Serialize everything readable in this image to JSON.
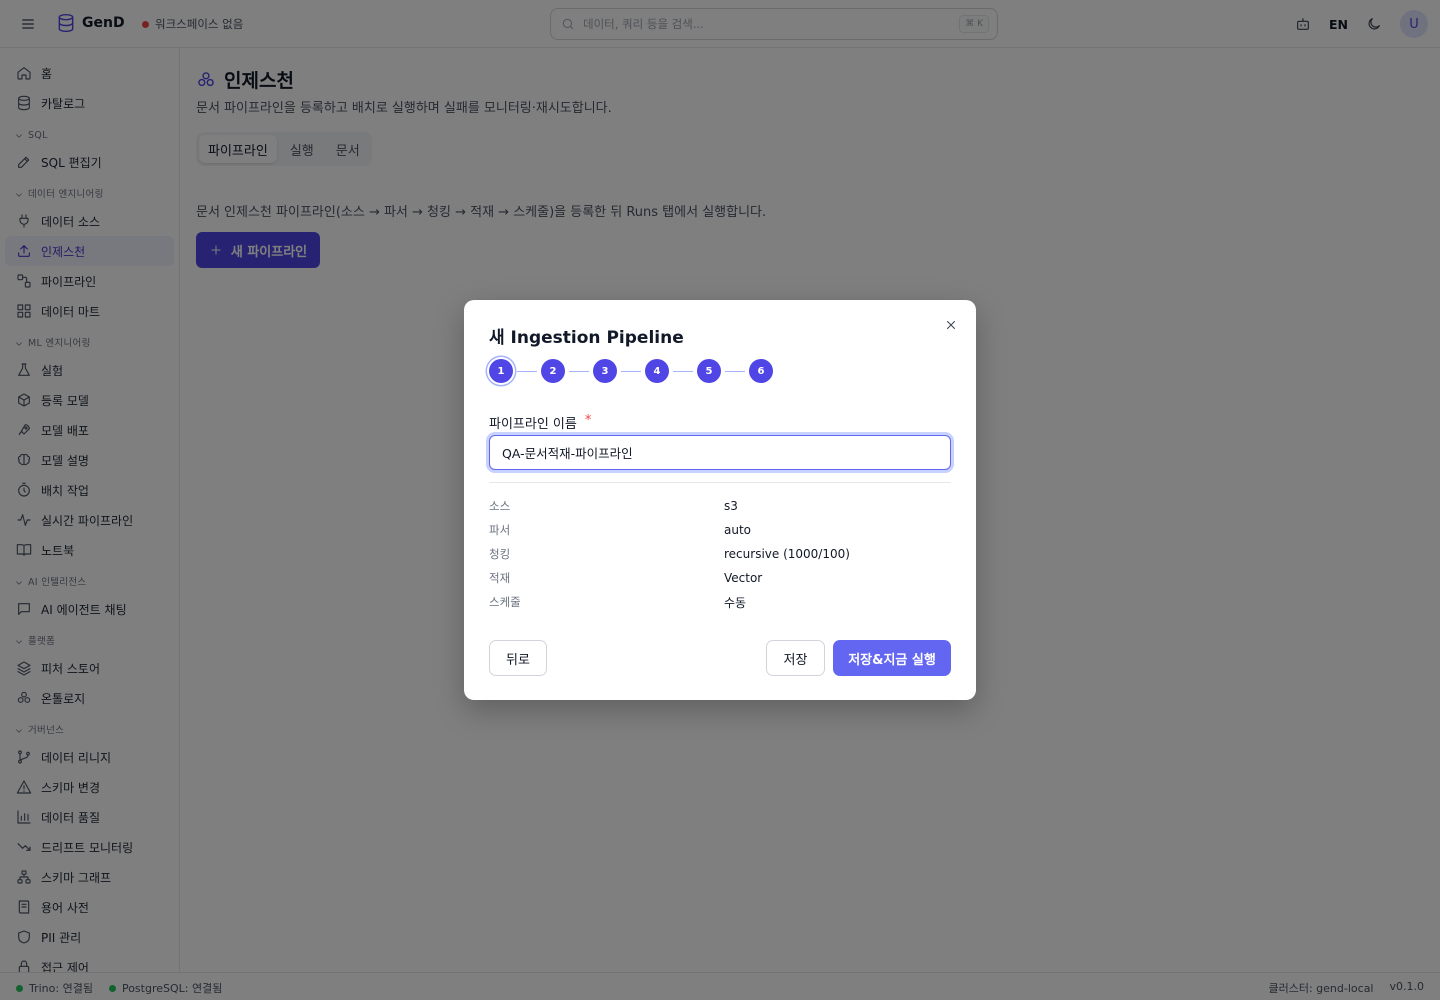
{
  "header": {
    "app_name": "GenD",
    "workspace": "워크스페이스 없음",
    "search_placeholder": "데이터, 쿼리 등을 검색...",
    "search_shortcut": "⌘ K",
    "lang": "EN",
    "avatar": "U"
  },
  "sidebar": {
    "top": [
      {
        "label": "홈",
        "icon": "home-icon"
      },
      {
        "label": "카탈로그",
        "icon": "database-icon"
      }
    ],
    "groups": [
      {
        "title": "SQL",
        "items": [
          {
            "label": "SQL 편집기",
            "icon": "edit-icon"
          }
        ]
      },
      {
        "title": "데이터 엔지니어링",
        "items": [
          {
            "label": "데이터 소스",
            "icon": "plug-icon"
          },
          {
            "label": "인제스천",
            "icon": "upload-icon",
            "active": true
          },
          {
            "label": "파이프라인",
            "icon": "workflow-icon"
          },
          {
            "label": "데이터 마트",
            "icon": "grid-icon"
          }
        ]
      },
      {
        "title": "ML 엔지니어링",
        "items": [
          {
            "label": "실험",
            "icon": "flask-icon"
          },
          {
            "label": "등록 모델",
            "icon": "box-icon"
          },
          {
            "label": "모델 배포",
            "icon": "rocket-icon"
          },
          {
            "label": "모델 설명",
            "icon": "brain-icon"
          },
          {
            "label": "배치 작업",
            "icon": "timer-icon"
          },
          {
            "label": "실시간 파이프라인",
            "icon": "activity-icon"
          },
          {
            "label": "노트북",
            "icon": "book-icon"
          }
        ]
      },
      {
        "title": "AI 인텔리전스",
        "items": [
          {
            "label": "AI 에이전트 채팅",
            "icon": "message-icon"
          }
        ]
      },
      {
        "title": "플랫폼",
        "items": [
          {
            "label": "피처 스토어",
            "icon": "layers-icon"
          },
          {
            "label": "온톨로지",
            "icon": "network-icon"
          }
        ]
      },
      {
        "title": "거버넌스",
        "items": [
          {
            "label": "데이터 리니지",
            "icon": "git-branch-icon"
          },
          {
            "label": "스키마 변경",
            "icon": "alert-triangle-icon"
          },
          {
            "label": "데이터 품질",
            "icon": "bar-chart-icon"
          },
          {
            "label": "드리프트 모니터링",
            "icon": "trending-down-icon"
          },
          {
            "label": "스키마 그래프",
            "icon": "sitemap-icon"
          },
          {
            "label": "용어 사전",
            "icon": "book-text-icon"
          },
          {
            "label": "PII 관리",
            "icon": "shield-icon"
          },
          {
            "label": "접근 제어",
            "icon": "lock-icon"
          }
        ]
      }
    ]
  },
  "page": {
    "title": "인제스천",
    "description": "문서 파이프라인을 등록하고 배치로 실행하며 실패를 모니터링·재시도합니다.",
    "tabs": [
      {
        "label": "파이프라인",
        "active": true
      },
      {
        "label": "실행"
      },
      {
        "label": "문서"
      }
    ],
    "pipeline_desc": "문서 인제스천 파이프라인(소스 → 파서 → 청킹 → 적재 → 스케줄)을 등록한 뒤 Runs 탭에서 실행합니다.",
    "new_button": "새 파이프라인"
  },
  "modal": {
    "title": "새 Ingestion Pipeline",
    "steps": [
      "1",
      "2",
      "3",
      "4",
      "5",
      "6"
    ],
    "current_step": 1,
    "name_label": "파이프라인 이름",
    "required_mark": "*",
    "name_value": "QA-문서적재-파이프라인",
    "summary": [
      {
        "key": "소스",
        "value": "s3"
      },
      {
        "key": "파서",
        "value": "auto"
      },
      {
        "key": "청킹",
        "value": "recursive (1000/100)"
      },
      {
        "key": "적재",
        "value": "Vector"
      },
      {
        "key": "스케줄",
        "value": "수동"
      }
    ],
    "back_label": "뒤로",
    "save_label": "저장",
    "save_run_label": "저장&지금 실행"
  },
  "footer": {
    "trino": "Trino: 연결됨",
    "postgres": "PostgreSQL: 연결됨",
    "cluster": "클러스터: gend-local",
    "version": "v0.1.0"
  },
  "colors": {
    "accent": "#4f46e5",
    "primary_button": "#6366f1",
    "status_ok": "#22c55e",
    "status_error": "#ef4444"
  }
}
